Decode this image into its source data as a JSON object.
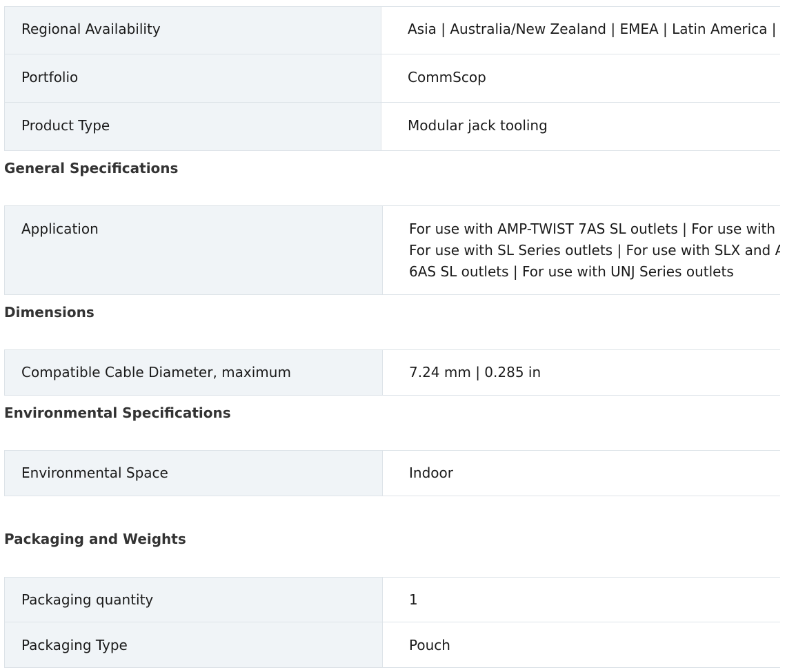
{
  "overview": {
    "rows": [
      {
        "label": "Regional Availability",
        "value": "Asia | Australia/New Zealand | EMEA | Latin America |"
      },
      {
        "label": "Portfolio",
        "value": "CommScop"
      },
      {
        "label": "Product Type",
        "value": "Modular jack tooling"
      }
    ]
  },
  "general": {
    "heading": "General Specifications",
    "rows": [
      {
        "label": "Application",
        "lines": [
          "For use with AMP-TWIST 7AS SL outlets | For use with",
          "For use with SL Series outlets | For use with SLX and A",
          "6AS SL outlets | For use with UNJ Series outlets"
        ]
      }
    ]
  },
  "dimensions": {
    "heading": "Dimensions",
    "rows": [
      {
        "label": "Compatible Cable Diameter, maximum",
        "value": "7.24 mm | 0.285 in"
      }
    ]
  },
  "environmental": {
    "heading": "Environmental Specifications",
    "rows": [
      {
        "label": "Environmental Space",
        "value": "Indoor"
      }
    ]
  },
  "packaging": {
    "heading": "Packaging and Weights",
    "rows": [
      {
        "label": "Packaging quantity",
        "value": "1"
      },
      {
        "label": "Packaging Type",
        "value": "Pouch"
      }
    ]
  }
}
